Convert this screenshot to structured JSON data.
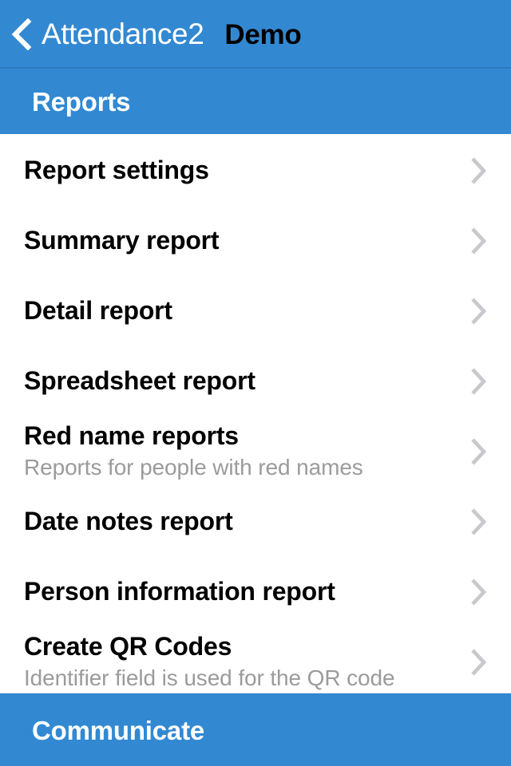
{
  "navbar": {
    "back_label": "Attendance2",
    "back_icon": "chevron-left-icon",
    "title": "Demo",
    "background_color": "#3289D2",
    "label_color": "#FFFFFF",
    "title_color": "#000000"
  },
  "sections": [
    {
      "header": "Reports",
      "rows": [
        {
          "title": "Report settings",
          "subtitle": "",
          "accessory": "chevron-right-icon"
        },
        {
          "title": "Summary report",
          "subtitle": "",
          "accessory": "chevron-right-icon"
        },
        {
          "title": "Detail report",
          "subtitle": "",
          "accessory": "chevron-right-icon"
        },
        {
          "title": "Spreadsheet report",
          "subtitle": "",
          "accessory": "chevron-right-icon"
        },
        {
          "title": "Red name reports",
          "subtitle": "Reports for people with red names",
          "accessory": "chevron-right-icon"
        },
        {
          "title": "Date notes report",
          "subtitle": "",
          "accessory": "chevron-right-icon"
        },
        {
          "title": "Person information report",
          "subtitle": "",
          "accessory": "chevron-right-icon"
        },
        {
          "title": "Create QR Codes",
          "subtitle": "Identifier field is used for the QR code",
          "accessory": "chevron-right-icon"
        }
      ]
    },
    {
      "header": "Communicate",
      "rows": []
    }
  ],
  "colors": {
    "accent_blue": "#3289D2",
    "navbar_border": "#2A7AC0",
    "row_title": "#000000",
    "row_subtitle": "#9B9B9B",
    "chevron_gray": "#C8C8CD",
    "page_background": "#FFFFFF"
  }
}
